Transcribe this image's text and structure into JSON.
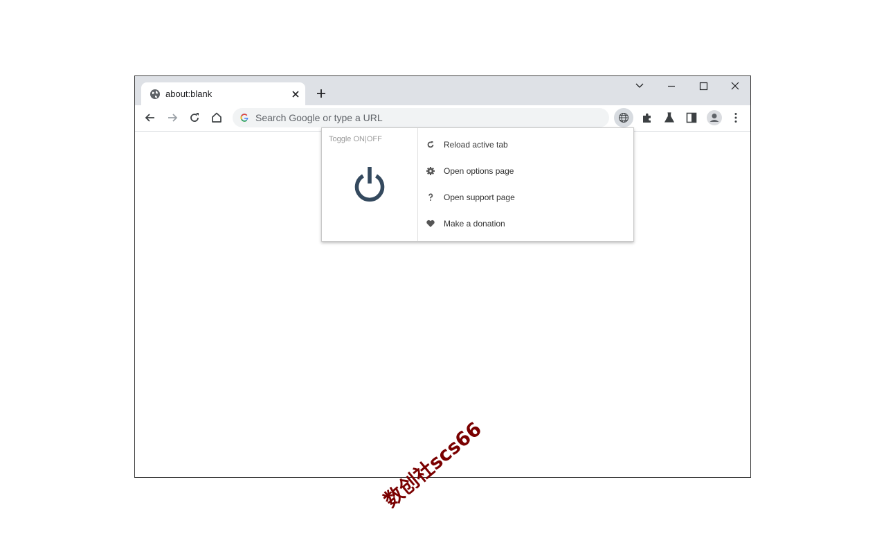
{
  "tab": {
    "title": "about:blank"
  },
  "omnibox": {
    "placeholder": "Search Google or type a URL"
  },
  "popup": {
    "toggle_label": "Toggle ON|OFF",
    "menu": [
      {
        "icon": "reload-icon",
        "label": "Reload active tab"
      },
      {
        "icon": "gear-icon",
        "label": "Open options page"
      },
      {
        "icon": "question-icon",
        "label": "Open support page"
      },
      {
        "icon": "heart-icon",
        "label": "Make a donation"
      }
    ]
  },
  "watermark": "数创社scs66",
  "colors": {
    "tabstrip": "#dee1e6",
    "power_icon": "#34495e",
    "watermark": "#7a0000"
  }
}
